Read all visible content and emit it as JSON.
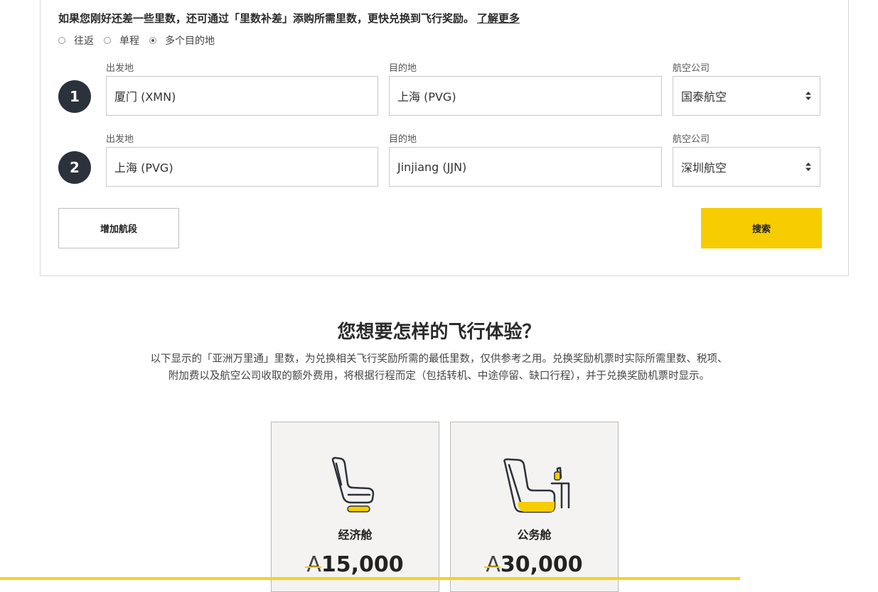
{
  "notice": {
    "text": "如果您刚好还差一些里数，还可通过「里数补差」添购所需里数，更快兑换到飞行奖励。",
    "link": "了解更多"
  },
  "trip_type": {
    "options": [
      "往返",
      "单程",
      "多个目的地"
    ],
    "selected": "多个目的地"
  },
  "segments": [
    {
      "number": "1",
      "origin_label": "出发地",
      "origin": "厦门 (XMN)",
      "destination_label": "目的地",
      "destination": "上海 (PVG)",
      "airline_label": "航空公司",
      "airline": "国泰航空"
    },
    {
      "number": "2",
      "origin_label": "出发地",
      "origin": "上海 (PVG)",
      "destination_label": "目的地",
      "destination": "Jinjiang (JJN)",
      "airline_label": "航空公司",
      "airline": "深圳航空"
    }
  ],
  "buttons": {
    "add_segment": "增加航段",
    "search": "搜索"
  },
  "experience": {
    "title": "您想要怎样的飞行体验？",
    "description_line1": "以下显示的「亚洲万里通」里数，为兑换相关飞行奖励所需的最低里数，仅供参考之用。兑换奖励机票时实际所需里数、税项、",
    "description_line2": "附加费以及航空公司收取的额外费用，将根据行程而定（包括转机、中途停留、缺口行程），并于兑换奖励机票时显示。"
  },
  "cabins": [
    {
      "name": "经济舱",
      "currency_symbol": "A",
      "miles": "15,000",
      "icon": "economy-seat-icon"
    },
    {
      "name": "公务舱",
      "currency_symbol": "A",
      "miles": "30,000",
      "icon": "business-seat-icon"
    }
  ],
  "colors": {
    "accent": "#f7cc00",
    "badge": "#2c323b",
    "card_bg": "#f4f3f1"
  }
}
